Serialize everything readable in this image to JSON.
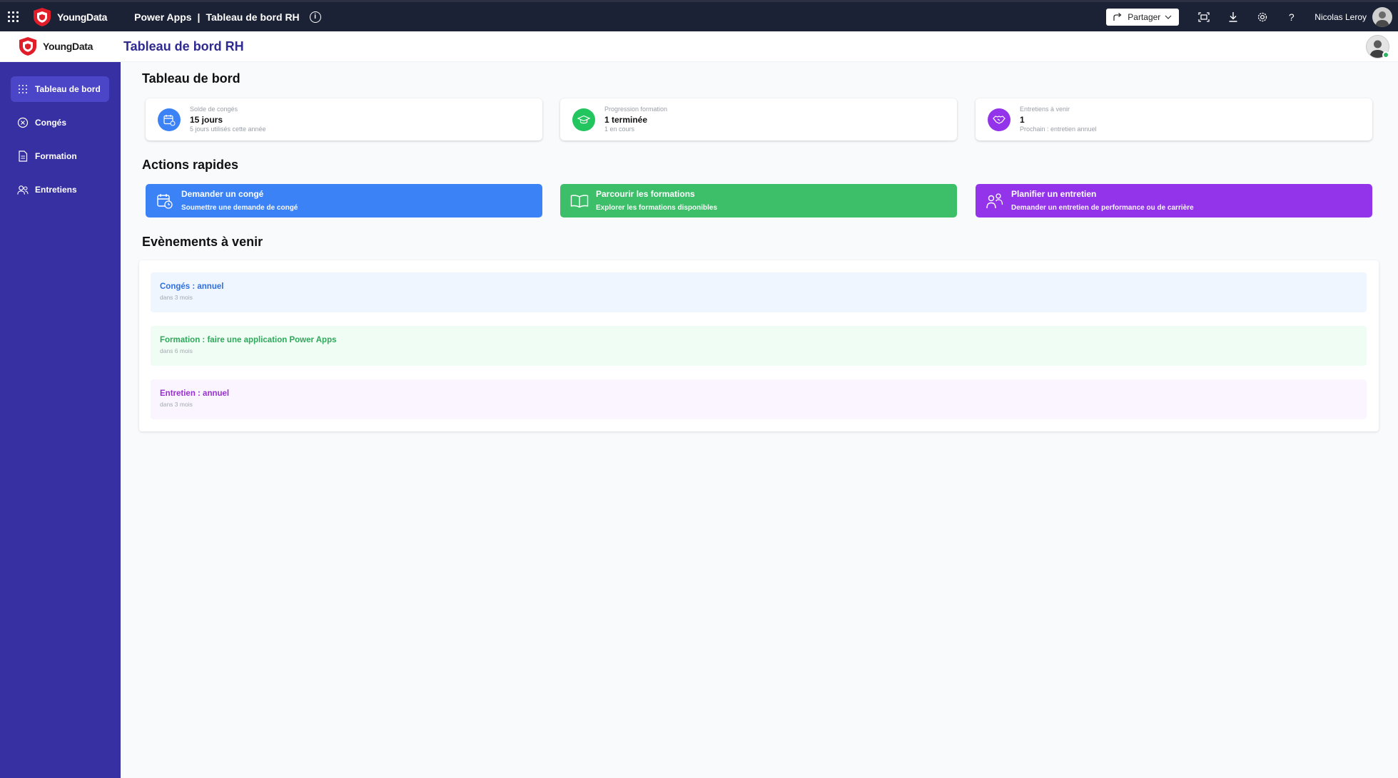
{
  "topbar": {
    "brand": "YoungData",
    "product": "Power Apps",
    "separator": "|",
    "app_name": "Tableau de bord RH",
    "share_label": "Partager",
    "user_name": "Nicolas Leroy",
    "background": "#1c2236"
  },
  "header": {
    "brand": "YoungData",
    "title": "Tableau de bord RH",
    "title_color": "#2e2a8f"
  },
  "sidebar": {
    "background": "#3730a3",
    "items": [
      {
        "label": "Tableau de bord",
        "icon": "grid-dots-icon",
        "active": true
      },
      {
        "label": "Congés",
        "icon": "circle-x-icon",
        "active": false
      },
      {
        "label": "Formation",
        "icon": "document-icon",
        "active": false
      },
      {
        "label": "Entretiens",
        "icon": "people-icon",
        "active": false
      }
    ]
  },
  "main": {
    "dashboard_title": "Tableau de bord",
    "stats": [
      {
        "label": "Solde de congés",
        "value": "15 jours",
        "sub": "5 jours utilisés cette année",
        "icon": "calendar-icon",
        "color": "#3b82f6"
      },
      {
        "label": "Progression formation",
        "value": "1 terminée",
        "sub": "1 en cours",
        "icon": "graduation-cap-icon",
        "color": "#22c55e"
      },
      {
        "label": "Entretiens à venir",
        "value": "1",
        "sub": "Prochain : entretien annuel",
        "icon": "handshake-icon",
        "color": "#9333ea"
      }
    ],
    "quick_actions_title": "Actions rapides",
    "actions": [
      {
        "title": "Demander un congé",
        "sub": "Soumettre une demande de congé",
        "icon": "calendar-clock-icon",
        "color": "#3b82f6"
      },
      {
        "title": "Parcourir les formations",
        "sub": "Explorer les formations disponibles",
        "icon": "open-book-icon",
        "color": "#3dbf6a"
      },
      {
        "title": "Planifier un entretien",
        "sub": "Demander un entretien de performance ou de carrière",
        "icon": "people-meeting-icon",
        "color": "#9333ea"
      }
    ],
    "events_title": "Evènements à venir",
    "events": [
      {
        "title": "Congés : annuel",
        "sub": "dans 3 mois",
        "color": "#2f6fe0",
        "bg": "#eff6ff"
      },
      {
        "title": "Formation : faire une application Power Apps",
        "sub": "dans 6 mois",
        "color": "#2ea85a",
        "bg": "#f0fdf4"
      },
      {
        "title": "Entretien : annuel",
        "sub": "dans 3 mois",
        "color": "#9a2fd0",
        "bg": "#faf5ff"
      }
    ]
  }
}
